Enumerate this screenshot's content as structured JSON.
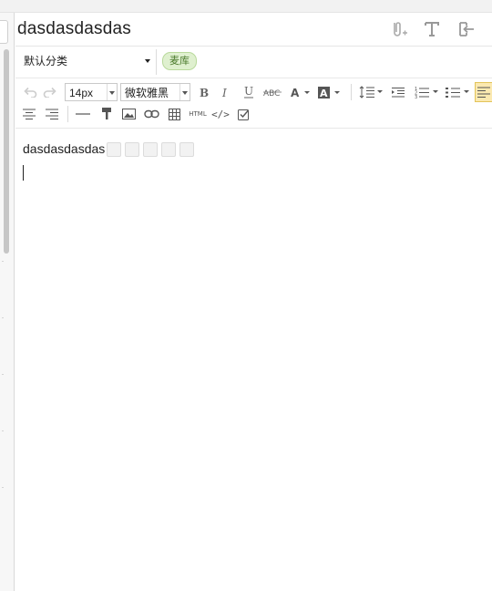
{
  "note": {
    "title": "dasdasdasdas",
    "category": "默认分类",
    "tag": "麦库",
    "body_line1": "dasdasdasdas"
  },
  "toolbar": {
    "font_size": "14px",
    "font_family": "微软雅黑",
    "html_label": "HTML",
    "code_label": "</>"
  },
  "icons": [
    "paperclip-add-icon",
    "text-format-icon",
    "exit-icon",
    "undo-icon",
    "redo-icon",
    "bold-icon",
    "italic-icon",
    "underline-icon",
    "strikethrough-icon",
    "font-color-icon",
    "highlight-icon",
    "line-height-icon",
    "indent-icon",
    "ordered-list-icon",
    "unordered-list-icon",
    "align-left-icon",
    "align-center-icon",
    "align-right-icon",
    "horizontal-rule-icon",
    "format-painter-icon",
    "image-icon",
    "link-icon",
    "table-icon",
    "checkbox-icon"
  ],
  "colors": {
    "tag_bg": "#dff0cf",
    "tag_text": "#4b7a2c",
    "active_button": "#fbe9b0"
  }
}
